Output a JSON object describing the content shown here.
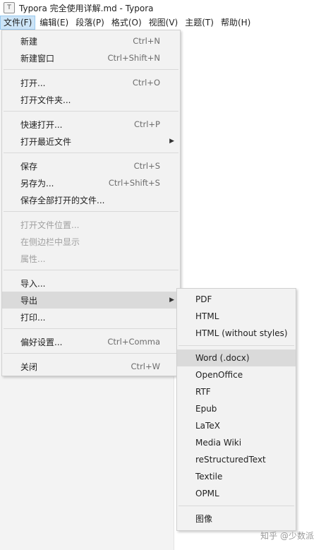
{
  "window": {
    "title": "Typora 完全使用详解.md - Typora",
    "app_icon": "T"
  },
  "menubar": [
    "文件(F)",
    "编辑(E)",
    "段落(P)",
    "格式(O)",
    "视图(V)",
    "主题(T)",
    "帮助(H)"
  ],
  "file_menu": {
    "new": {
      "label": "新建",
      "shortcut": "Ctrl+N"
    },
    "new_window": {
      "label": "新建窗口",
      "shortcut": "Ctrl+Shift+N"
    },
    "open": {
      "label": "打开...",
      "shortcut": "Ctrl+O"
    },
    "open_folder": {
      "label": "打开文件夹..."
    },
    "quick_open": {
      "label": "快速打开...",
      "shortcut": "Ctrl+P"
    },
    "open_recent": {
      "label": "打开最近文件"
    },
    "save": {
      "label": "保存",
      "shortcut": "Ctrl+S"
    },
    "save_as": {
      "label": "另存为...",
      "shortcut": "Ctrl+Shift+S"
    },
    "save_all": {
      "label": "保存全部打开的文件..."
    },
    "open_location": {
      "label": "打开文件位置..."
    },
    "reveal_sidebar": {
      "label": "在侧边栏中显示"
    },
    "properties": {
      "label": "属性..."
    },
    "import": {
      "label": "导入..."
    },
    "export": {
      "label": "导出"
    },
    "print": {
      "label": "打印..."
    },
    "preferences": {
      "label": "偏好设置...",
      "shortcut": "Ctrl+Comma"
    },
    "close": {
      "label": "关闭",
      "shortcut": "Ctrl+W"
    }
  },
  "export_menu": [
    "PDF",
    "HTML",
    "HTML (without styles)",
    "Word (.docx)",
    "OpenOffice",
    "RTF",
    "Epub",
    "LaTeX",
    "Media Wiki",
    "reStructuredText",
    "Textile",
    "OPML",
    "图像"
  ],
  "watermark": "知乎 @少数派",
  "colors": {
    "menu_bg": "#f2f2f2",
    "highlight": "#dadada",
    "menubar_active": "#cce4f7"
  }
}
